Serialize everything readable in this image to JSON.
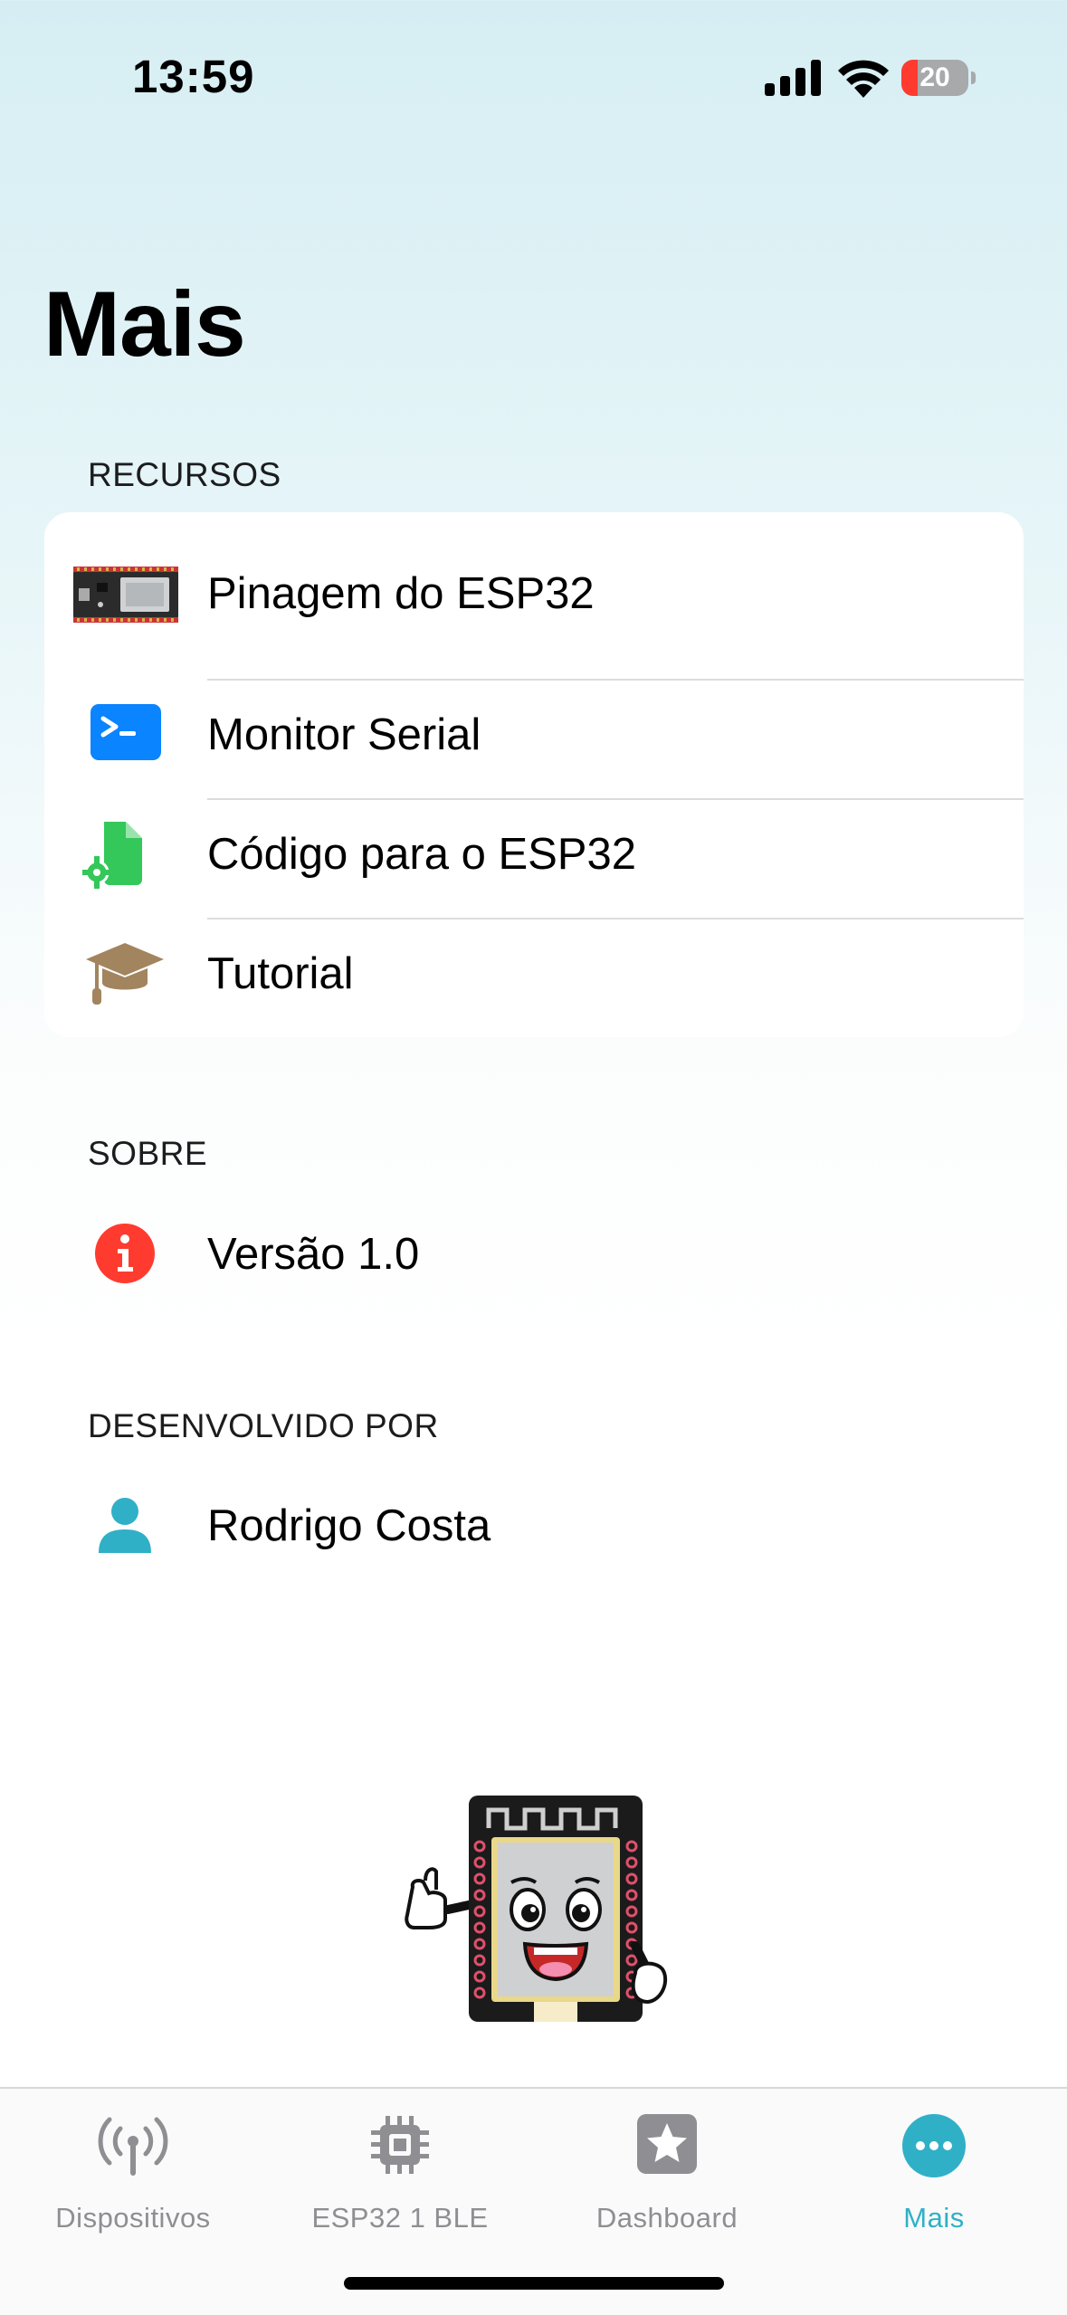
{
  "status_bar": {
    "time": "13:59",
    "battery_level": "20"
  },
  "page_title": "Mais",
  "sections": {
    "recursos": {
      "header": "RECURSOS",
      "items": [
        {
          "label": "Pinagem do ESP32",
          "icon": "esp32-board-icon"
        },
        {
          "label": "Monitor Serial",
          "icon": "terminal-icon"
        },
        {
          "label": "Código para o ESP32",
          "icon": "code-file-gear-icon"
        },
        {
          "label": "Tutorial",
          "icon": "graduation-cap-icon"
        }
      ]
    },
    "sobre": {
      "header": "SOBRE",
      "items": [
        {
          "label": "Versão 1.0",
          "icon": "info-icon"
        }
      ]
    },
    "desenvolvido": {
      "header": "DESENVOLVIDO POR",
      "items": [
        {
          "label": "Rodrigo Costa",
          "icon": "person-icon"
        }
      ]
    }
  },
  "tab_bar": {
    "tabs": [
      {
        "label": "Dispositivos",
        "icon": "antenna-icon",
        "active": false
      },
      {
        "label": "ESP32 1 BLE",
        "icon": "cpu-icon",
        "active": false
      },
      {
        "label": "Dashboard",
        "icon": "star-square-icon",
        "active": false
      },
      {
        "label": "Mais",
        "icon": "ellipsis-circle-icon",
        "active": true
      }
    ]
  },
  "colors": {
    "accent": "#30b0c7",
    "terminal_blue": "#0a84ff",
    "code_green": "#34c759",
    "tutorial_brown": "#a2845e",
    "info_red": "#ff3b30",
    "person_teal": "#30b0c7"
  }
}
